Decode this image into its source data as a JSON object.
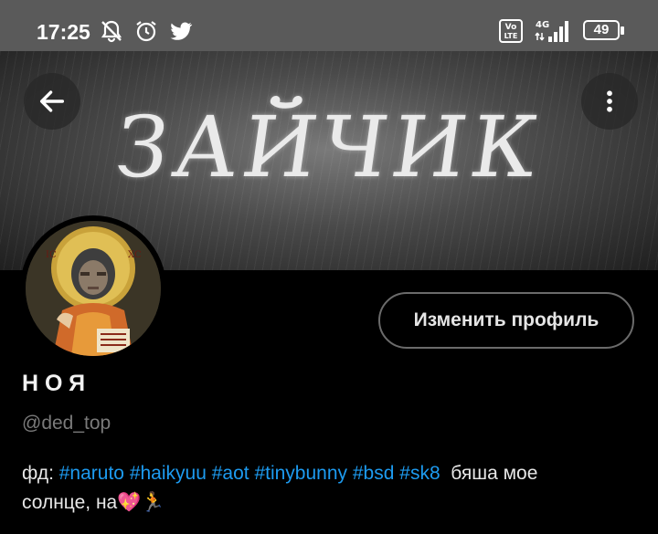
{
  "status_bar": {
    "time": "17:25",
    "battery": "49",
    "network": "4G",
    "volte": "Vo LTE"
  },
  "banner": {
    "title": "ЗАЙЧИК"
  },
  "profile": {
    "edit_button_label": "Изменить профиль",
    "display_name": "НОЯ",
    "handle": "@ded_top"
  },
  "bio": {
    "prefix": "фд: ",
    "hashtags": [
      "#naruto",
      "#haikyuu",
      "#aot",
      "#tinybunny",
      "#bsd",
      "#sk8"
    ],
    "suffix_line1": "бяша мое",
    "line2": "солнце, на",
    "emoji": "💖🏃"
  },
  "colors": {
    "background": "#000000",
    "accent_link": "#1d9bf0",
    "status_bar": "#5a5a5a"
  }
}
